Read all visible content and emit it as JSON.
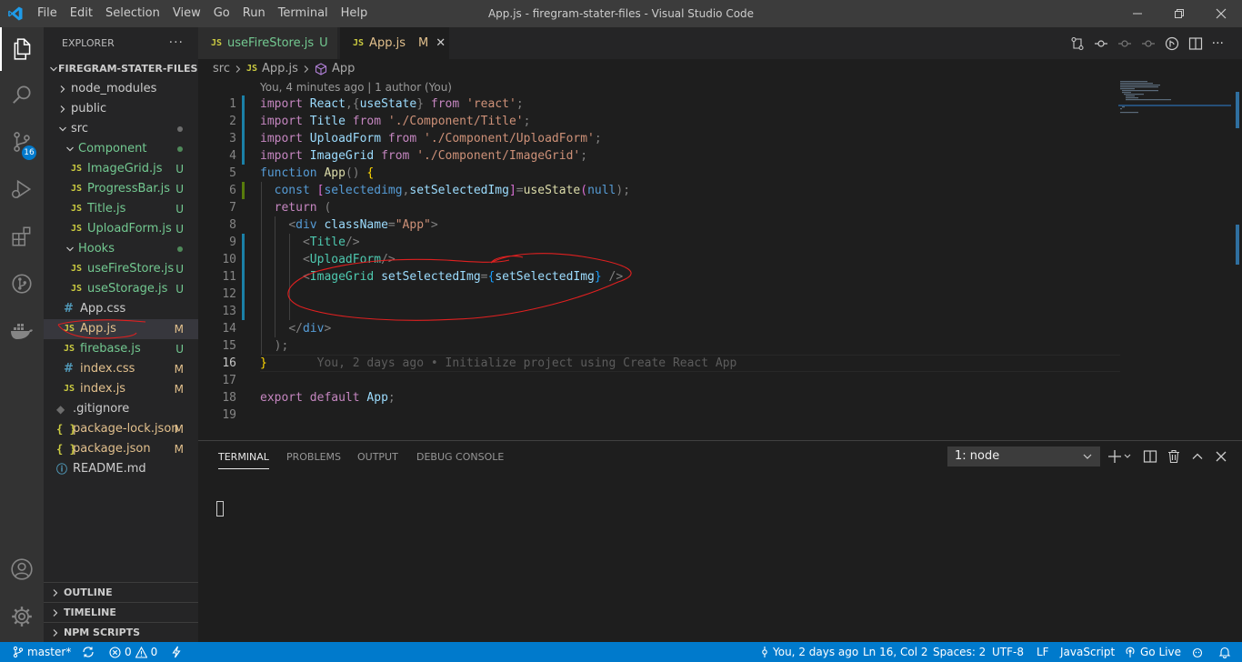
{
  "window": {
    "title": "App.js - firegram-stater-files - Visual Studio Code",
    "menu": [
      "File",
      "Edit",
      "Selection",
      "View",
      "Go",
      "Run",
      "Terminal",
      "Help"
    ]
  },
  "activity_bar": {
    "items": [
      "explorer-icon",
      "search-icon",
      "source-control-icon",
      "run-debug-icon",
      "extensions-icon",
      "git-history-icon",
      "docker-icon"
    ],
    "source_control_badge": "16",
    "bottom": [
      "accounts-icon",
      "settings-gear-icon"
    ]
  },
  "sidebar": {
    "title": "EXPLORER",
    "more": "···",
    "root": "FIREGRAM-STATER-FILES",
    "tree": [
      {
        "label": "node_modules",
        "type": "folder",
        "depth": 0,
        "open": false,
        "status": ""
      },
      {
        "label": "public",
        "type": "folder",
        "depth": 0,
        "open": false,
        "status": ""
      },
      {
        "label": "src",
        "type": "folder",
        "depth": 0,
        "open": true,
        "status": "dot"
      },
      {
        "label": "Component",
        "type": "folder",
        "depth": 1,
        "open": true,
        "status": "dot-green"
      },
      {
        "label": "ImageGrid.js",
        "type": "js",
        "depth": 2,
        "status": "U"
      },
      {
        "label": "ProgressBar.js",
        "type": "js",
        "depth": 2,
        "status": "U"
      },
      {
        "label": "Title.js",
        "type": "js",
        "depth": 2,
        "status": "U"
      },
      {
        "label": "UploadForm.js",
        "type": "js",
        "depth": 2,
        "status": "U"
      },
      {
        "label": "Hooks",
        "type": "folder",
        "depth": 1,
        "open": true,
        "status": "dot-green"
      },
      {
        "label": "useFireStore.js",
        "type": "js",
        "depth": 2,
        "status": "U"
      },
      {
        "label": "useStorage.js",
        "type": "js",
        "depth": 2,
        "status": "U"
      },
      {
        "label": "App.css",
        "type": "css",
        "depth": 1,
        "status": ""
      },
      {
        "label": "App.js",
        "type": "js",
        "depth": 1,
        "status": "M",
        "selected": true
      },
      {
        "label": "firebase.js",
        "type": "js",
        "depth": 1,
        "status": "U"
      },
      {
        "label": "index.css",
        "type": "css",
        "depth": 1,
        "status": "M"
      },
      {
        "label": "index.js",
        "type": "js",
        "depth": 1,
        "status": "M"
      },
      {
        "label": ".gitignore",
        "type": "git",
        "depth": 0,
        "status": ""
      },
      {
        "label": "package-lock.json",
        "type": "json",
        "depth": 0,
        "status": "M"
      },
      {
        "label": "package.json",
        "type": "json",
        "depth": 0,
        "status": "M"
      },
      {
        "label": "README.md",
        "type": "md",
        "depth": 0,
        "status": ""
      }
    ],
    "sections": [
      "OUTLINE",
      "TIMELINE",
      "NPM SCRIPTS"
    ]
  },
  "tabs": [
    {
      "icon": "JS",
      "label": "useFireStore.js",
      "status": "U",
      "active": false
    },
    {
      "icon": "JS",
      "label": "App.js",
      "status": "M",
      "active": true,
      "close": "✕"
    }
  ],
  "breadcrumb": {
    "folder": "src",
    "file_icon": "JS",
    "file": "App.js",
    "symbol": "App"
  },
  "editor": {
    "codelens": "You, 4 minutes ago | 1 author (You)",
    "current_line": 16,
    "lines": [
      {
        "n": "1",
        "git": "modified"
      },
      {
        "n": "2",
        "git": "modified"
      },
      {
        "n": "3",
        "git": "modified"
      },
      {
        "n": "4",
        "git": "modified"
      },
      {
        "n": "5",
        "git": ""
      },
      {
        "n": "6",
        "git": "added"
      },
      {
        "n": "7",
        "git": ""
      },
      {
        "n": "8",
        "git": ""
      },
      {
        "n": "9",
        "git": "modified"
      },
      {
        "n": "10",
        "git": "modified"
      },
      {
        "n": "11",
        "git": "modified"
      },
      {
        "n": "12",
        "git": "modified"
      },
      {
        "n": "13",
        "git": "modified"
      },
      {
        "n": "14",
        "git": ""
      },
      {
        "n": "15",
        "git": ""
      },
      {
        "n": "16",
        "git": ""
      },
      {
        "n": "17",
        "git": ""
      },
      {
        "n": "18",
        "git": ""
      },
      {
        "n": "19",
        "git": ""
      }
    ],
    "code": {
      "l1": [
        "import",
        " ",
        "React",
        ",{",
        "useState",
        "} ",
        "from",
        " ",
        "'react'",
        ";"
      ],
      "l2": [
        "import",
        " ",
        "Title",
        " ",
        "from",
        " ",
        "'./Component/Title'",
        ";"
      ],
      "l3": [
        "import",
        " ",
        "UploadForm",
        " ",
        "from",
        " ",
        "'./Component/UploadForm'",
        ";"
      ],
      "l4": [
        "import",
        " ",
        "ImageGrid",
        " ",
        "from",
        " ",
        "'./Component/ImageGrid'",
        ";"
      ],
      "l5": [
        "function",
        " ",
        "App",
        "() ",
        "{"
      ],
      "l6": [
        "  ",
        "const",
        " ",
        "[",
        "selectedimg",
        ",",
        "setSelectedImg",
        "]",
        "=",
        "useState",
        "(",
        "null",
        ");"
      ],
      "l7": [
        "  ",
        "return",
        " ("
      ],
      "l8": [
        "    ",
        "<",
        "div",
        " ",
        "className",
        "=",
        "\"App\"",
        ">"
      ],
      "l9": [
        "      ",
        "<",
        "Title",
        "/>"
      ],
      "l10": [
        "      ",
        "<",
        "UploadForm",
        "/>"
      ],
      "l11": [
        "      ",
        "<",
        "ImageGrid",
        " ",
        "setSelectedImg",
        "=",
        "{",
        "setSelectedImg",
        "}",
        " />"
      ],
      "l14": [
        "    ",
        "</",
        "div",
        ">"
      ],
      "l15": [
        "  ",
        ");"
      ],
      "l16": [
        "}",
        "       You, 2 days ago • Initialize project using Create React App"
      ],
      "l18": [
        "export",
        " ",
        "default",
        " ",
        "App",
        ";"
      ]
    }
  },
  "panel": {
    "tabs": [
      "TERMINAL",
      "PROBLEMS",
      "OUTPUT",
      "DEBUG CONSOLE"
    ],
    "active_tab": "TERMINAL",
    "terminal_select": "1: node",
    "actions": [
      "add-terminal-icon",
      "split-terminal-icon",
      "trash-icon",
      "maximize-panel-icon",
      "close-panel-icon"
    ]
  },
  "statusbar": {
    "branch": "master*",
    "errors": "0",
    "warnings": "0",
    "blame": "You, 2 days ago",
    "position": "Ln 16, Col 2",
    "spaces": "Spaces: 2",
    "encoding": "UTF-8",
    "eol": "LF",
    "language": "JavaScript",
    "golive": "Go Live"
  },
  "colors": {
    "accent": "#007acc",
    "untracked": "#73c991",
    "modified": "#e2c08d",
    "annotation": "#e02020"
  }
}
